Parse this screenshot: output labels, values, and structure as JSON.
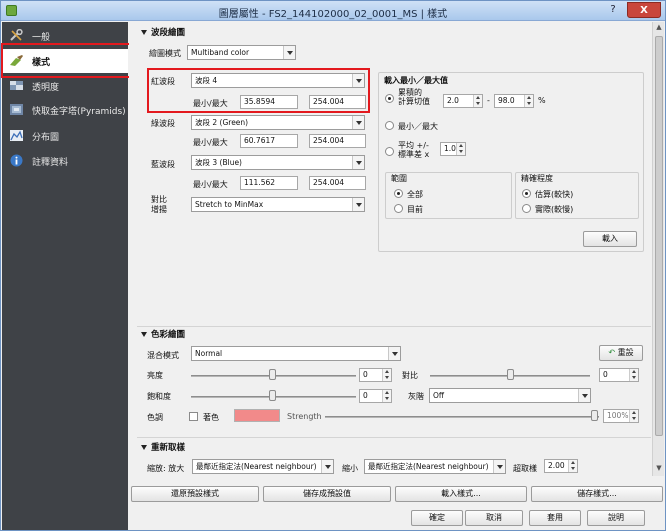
{
  "window": {
    "title": "圖層屬性 - FS2_144102000_02_0001_MS | 樣式",
    "help": "?",
    "close": "X"
  },
  "sidebar": {
    "items": [
      {
        "label": "一般",
        "icon": "wrench-icon"
      },
      {
        "label": "樣式",
        "icon": "brush-icon"
      },
      {
        "label": "透明度",
        "icon": "transparency-icon"
      },
      {
        "label": "快取金字塔(Pyramids)",
        "icon": "pyramid-icon"
      },
      {
        "label": "分布圖",
        "icon": "histogram-icon"
      },
      {
        "label": "註釋資料",
        "icon": "info-icon"
      }
    ]
  },
  "band_render": {
    "section_title": "波段繪圖",
    "render_type_label": "繪圖模式",
    "render_type_value": "Multiband color",
    "red_label": "紅波段",
    "red_value": "波段 4",
    "green_label": "綠波段",
    "green_value": "波段 2 (Green)",
    "blue_label": "藍波段",
    "blue_value": "波段 3 (Blue)",
    "minmax_label": "最小/最大",
    "red_min": "35.8594",
    "red_max": "254.004",
    "green_min": "60.7617",
    "green_max": "254.004",
    "blue_min": "111.562",
    "blue_max": "254.004",
    "contrast_label": "對比\n增揚",
    "contrast_value": "Stretch to MinMax"
  },
  "load_minmax": {
    "title": "載入最小／最大值",
    "cumulative_label": "累積的\n計算切值",
    "cumulative_low": "2.0",
    "dash": "-",
    "cumulative_high": "98.0",
    "percent": "%",
    "minmax_label": "最小／最大",
    "mean_label": "平均 +/-\n標準差 x",
    "mean_value": "1.00",
    "extent_title": "範圍",
    "extent_full": "全部",
    "extent_current": "目前",
    "accuracy_title": "精確程度",
    "accuracy_estimate": "估算(較快)",
    "accuracy_actual": "實際(較慢)",
    "load_button": "載入"
  },
  "color_render": {
    "section_title": "色彩繪圖",
    "blend_label": "混合模式",
    "blend_value": "Normal",
    "reset_label": "重設",
    "brightness_label": "亮度",
    "brightness_value": "0",
    "contrast_label": "對比",
    "contrast_value": "0",
    "saturation_label": "飽和度",
    "saturation_value": "0",
    "grayscale_label": "灰階",
    "grayscale_value": "Off",
    "hue_label": "色調",
    "colorize_label": "著色",
    "strength_label": "Strength",
    "strength_value": "100%",
    "colorize_color": "#f28a8a"
  },
  "resampling": {
    "section_title": "重新取樣",
    "zoom_in_label": "縮放: 放大",
    "zoom_in_value": "最鄰近指定法(Nearest neighbour)",
    "zoom_out_label": "縮小",
    "zoom_out_value": "最鄰近指定法(Nearest neighbour)",
    "oversampling_label": "超取樣",
    "oversampling_value": "2.00"
  },
  "style_buttons": {
    "restore_default": "還原預設樣式",
    "save_default": "儲存成預設值",
    "load_style": "載入樣式...",
    "save_style": "儲存樣式..."
  },
  "dialog_buttons": {
    "ok": "確定",
    "cancel": "取消",
    "apply": "套用",
    "help": "說明"
  }
}
